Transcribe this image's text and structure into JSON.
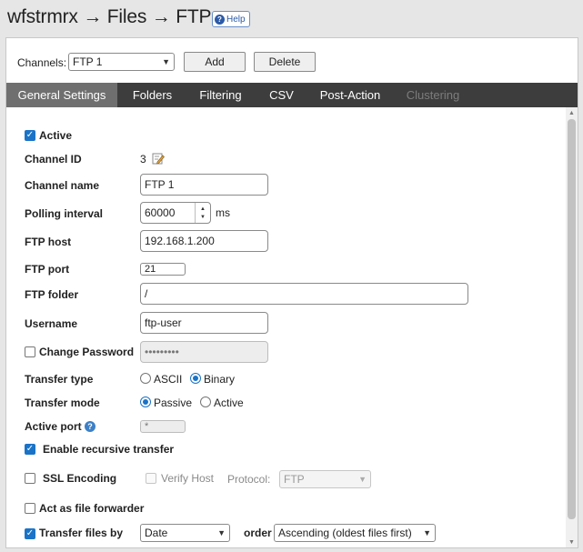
{
  "header": {
    "title": "wfstrmrx → Files → FTP",
    "help_label": "Help"
  },
  "toolbar": {
    "channels_label": "Channels:",
    "channel_selected": "FTP 1",
    "add_label": "Add",
    "delete_label": "Delete"
  },
  "tabs": [
    {
      "label": "General Settings",
      "state": "active"
    },
    {
      "label": "Folders",
      "state": "normal"
    },
    {
      "label": "Filtering",
      "state": "normal"
    },
    {
      "label": "CSV",
      "state": "normal"
    },
    {
      "label": "Post-Action",
      "state": "normal"
    },
    {
      "label": "Clustering",
      "state": "disabled"
    }
  ],
  "form": {
    "active": {
      "label": "Active",
      "checked": true
    },
    "channel_id": {
      "label": "Channel ID",
      "value": "3"
    },
    "channel_name": {
      "label": "Channel name",
      "value": "FTP 1"
    },
    "polling_interval": {
      "label": "Polling interval",
      "value": "60000",
      "unit": "ms"
    },
    "ftp_host": {
      "label": "FTP host",
      "value": "192.168.1.200"
    },
    "ftp_port": {
      "label": "FTP port",
      "value": "21"
    },
    "ftp_folder": {
      "label": "FTP folder",
      "value": "/"
    },
    "username": {
      "label": "Username",
      "value": "ftp-user"
    },
    "change_password": {
      "label": "Change Password",
      "checked": false,
      "masked_value": "•••••••••"
    },
    "transfer_type": {
      "label": "Transfer type",
      "options": [
        "ASCII",
        "Binary"
      ],
      "selected": "Binary"
    },
    "transfer_mode": {
      "label": "Transfer mode",
      "options": [
        "Passive",
        "Active"
      ],
      "selected": "Passive"
    },
    "active_port": {
      "label": "Active port",
      "value": "*"
    },
    "recursive": {
      "label": "Enable recursive transfer",
      "checked": true
    },
    "ssl": {
      "label": "SSL Encoding",
      "checked": false,
      "verify_host_label": "Verify Host",
      "protocol_label": "Protocol:",
      "protocol_value": "FTP"
    },
    "forwarder": {
      "label": "Act as file forwarder",
      "checked": false
    },
    "transfer_by": {
      "label": "Transfer files by",
      "checked": true,
      "by_value": "Date",
      "order_label": "order",
      "order_value": "Ascending (oldest files first)"
    }
  },
  "colors": {
    "accent": "#1a73c7",
    "tab_bar": "#3d3d3d",
    "tab_active": "#6f6f6f"
  }
}
